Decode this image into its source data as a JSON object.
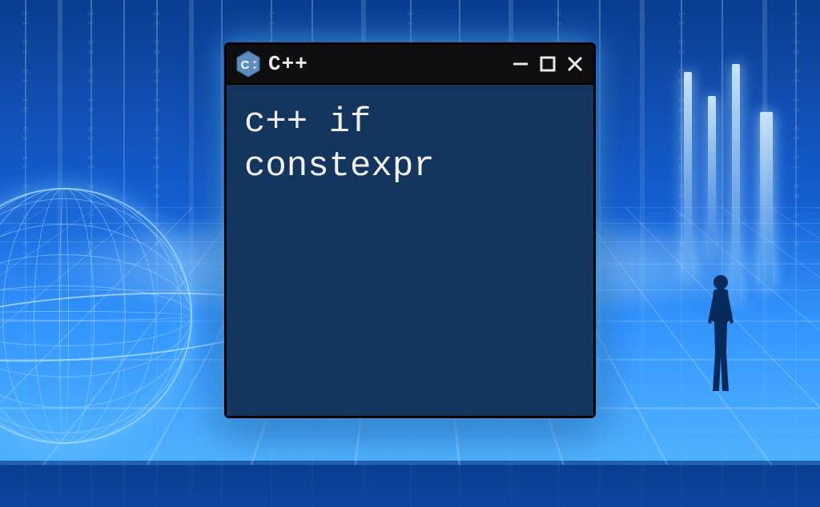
{
  "window": {
    "title": "C++",
    "logo_letter": "C",
    "logo_plus": "++",
    "body_text": "c++ if constexpr"
  },
  "colors": {
    "body_bg": "#14355d",
    "titlebar_bg": "#0f0f0f",
    "text": "#f0f0ed",
    "logo_hex": "#5c8dbc",
    "glow": "#5fb6ff"
  }
}
